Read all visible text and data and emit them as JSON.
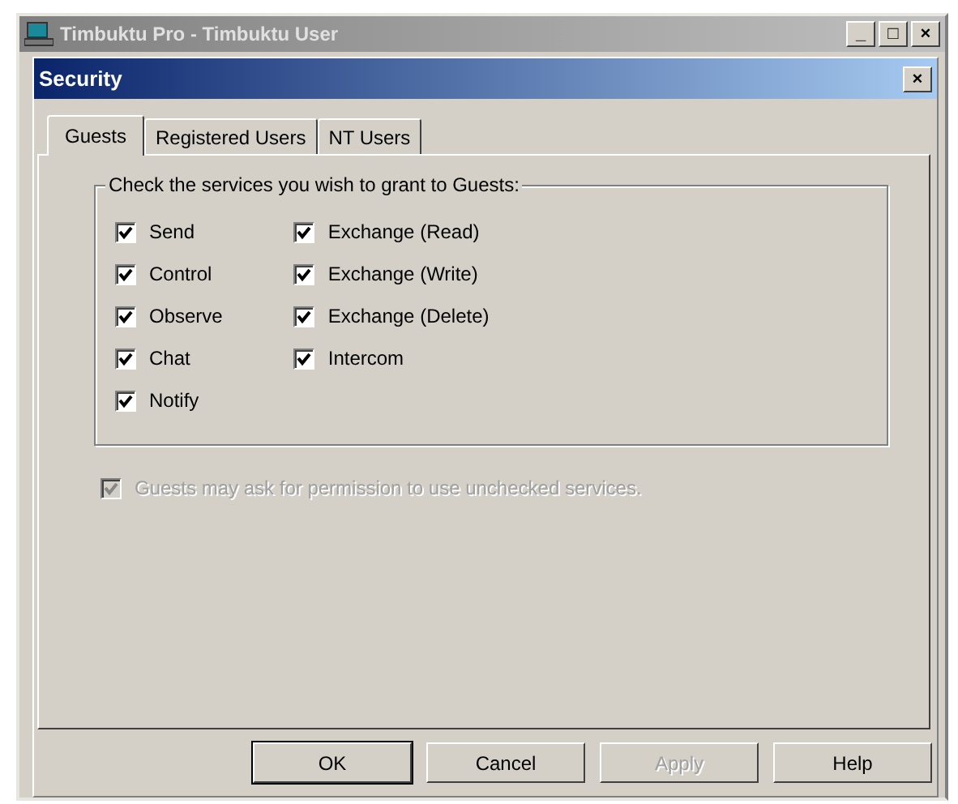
{
  "window": {
    "title": "Timbuktu Pro - Timbuktu User",
    "controls": [
      "_",
      "□",
      "×"
    ]
  },
  "dialog": {
    "title": "Security",
    "close": "×"
  },
  "tabs": [
    {
      "label": "Guests",
      "selected": true
    },
    {
      "label": "Registered Users",
      "selected": false
    },
    {
      "label": "NT Users",
      "selected": false
    }
  ],
  "group": {
    "label": "Check the services you wish to grant to Guests:",
    "columns": [
      [
        {
          "label": "Send",
          "checked": true
        },
        {
          "label": "Control",
          "checked": true
        },
        {
          "label": "Observe",
          "checked": true
        },
        {
          "label": "Chat",
          "checked": true
        },
        {
          "label": "Notify",
          "checked": true
        }
      ],
      [
        {
          "label": "Exchange (Read)",
          "checked": true
        },
        {
          "label": "Exchange (Write)",
          "checked": true
        },
        {
          "label": "Exchange (Delete)",
          "checked": true
        },
        {
          "label": "Intercom",
          "checked": true
        }
      ]
    ]
  },
  "permission": {
    "label": "Guests may ask for permission to use unchecked services.",
    "checked": true,
    "disabled": true
  },
  "buttons": [
    {
      "label": "OK",
      "default": true,
      "disabled": false
    },
    {
      "label": "Cancel",
      "default": false,
      "disabled": false
    },
    {
      "label": "Apply",
      "default": false,
      "disabled": true
    },
    {
      "label": "Help",
      "default": false,
      "disabled": false
    }
  ]
}
